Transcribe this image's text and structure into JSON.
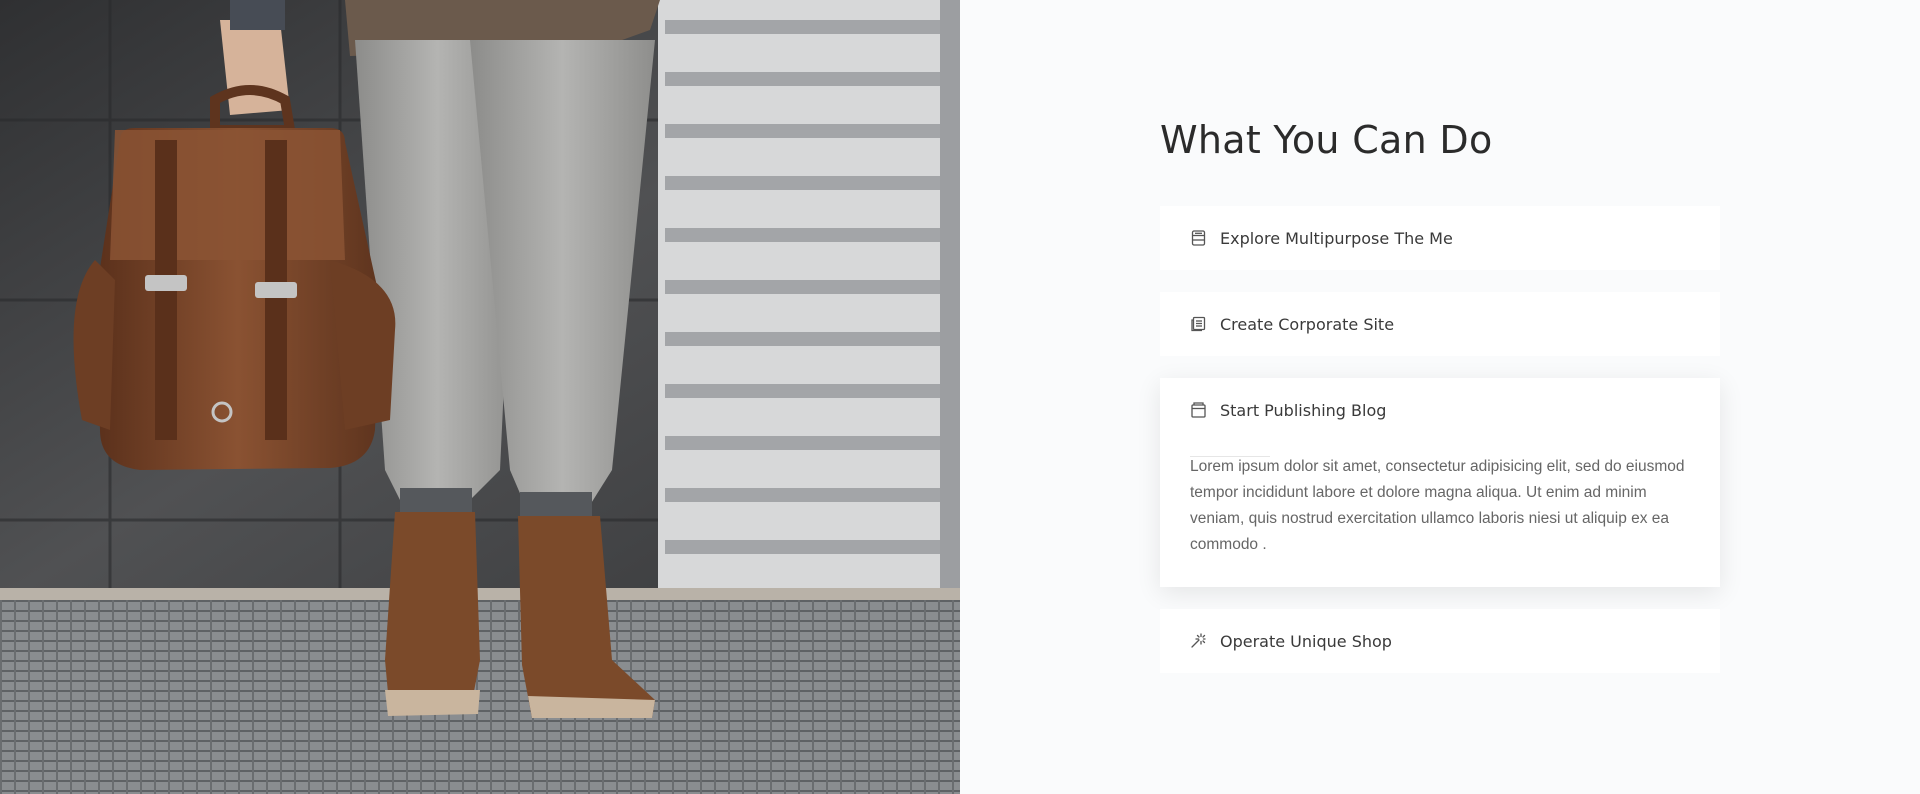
{
  "section": {
    "heading": "What You Can Do"
  },
  "accordion": {
    "items": [
      {
        "title": "Explore Multipurpose The Me",
        "icon": "drawer-icon",
        "expanded": false
      },
      {
        "title": "Create Corporate Site",
        "icon": "document-list-icon",
        "expanded": false
      },
      {
        "title": "Start Publishing Blog",
        "icon": "browser-window-icon",
        "expanded": true,
        "body": "Lorem ipsum dolor sit amet, consectetur adipisicing elit, sed do eiusmod tempor incididunt labore et dolore magna aliqua. Ut enim ad minim veniam, quis nostrud exercitation ullamco laboris niesi ut aliquip ex ea commodo ."
      },
      {
        "title": "Operate Unique Shop",
        "icon": "sparkle-icon",
        "expanded": false
      }
    ]
  },
  "colors": {
    "background": "#fafbfc",
    "heading": "#2b2b2b",
    "card": "#ffffff",
    "body_text": "#666666"
  }
}
